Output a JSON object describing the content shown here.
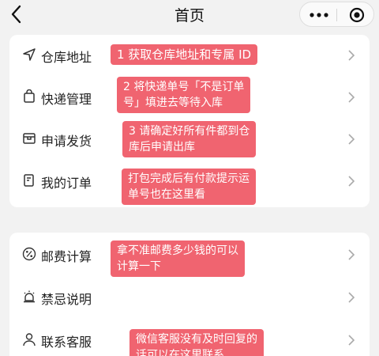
{
  "header": {
    "title": "首页",
    "dots_symbol": "•••"
  },
  "menu1": [
    {
      "label": "仓库地址"
    },
    {
      "label": "快递管理"
    },
    {
      "label": "申请发货"
    },
    {
      "label": "我的订单"
    }
  ],
  "menu2": [
    {
      "label": "邮费计算"
    },
    {
      "label": "禁忌说明"
    },
    {
      "label": "联系客服"
    }
  ],
  "notes": [
    {
      "lines": [
        "1 获取仓库地址和专属 ID"
      ]
    },
    {
      "lines": [
        "2 将快递单号「不是订单",
        "号」填进去等待入库"
      ]
    },
    {
      "lines": [
        "3 请确定好所有件都到仓",
        "库后申请出库"
      ]
    },
    {
      "lines": [
        "打包完成后有付款提示运",
        "单号也在这里看"
      ]
    },
    {
      "lines": [
        "拿不准邮费多少钱的可以",
        "计算一下"
      ]
    },
    {
      "lines": [
        "微信客服没有及时回复的",
        "话可以在这里联系"
      ]
    }
  ],
  "icons": [
    "location-arrow-icon",
    "bag-icon",
    "box-icon",
    "receipt-icon",
    "percent-icon",
    "alarm-icon",
    "person-icon"
  ],
  "colors": {
    "note_bg": "#f06470",
    "background": "#f2f2f2",
    "card": "#ffffff"
  }
}
